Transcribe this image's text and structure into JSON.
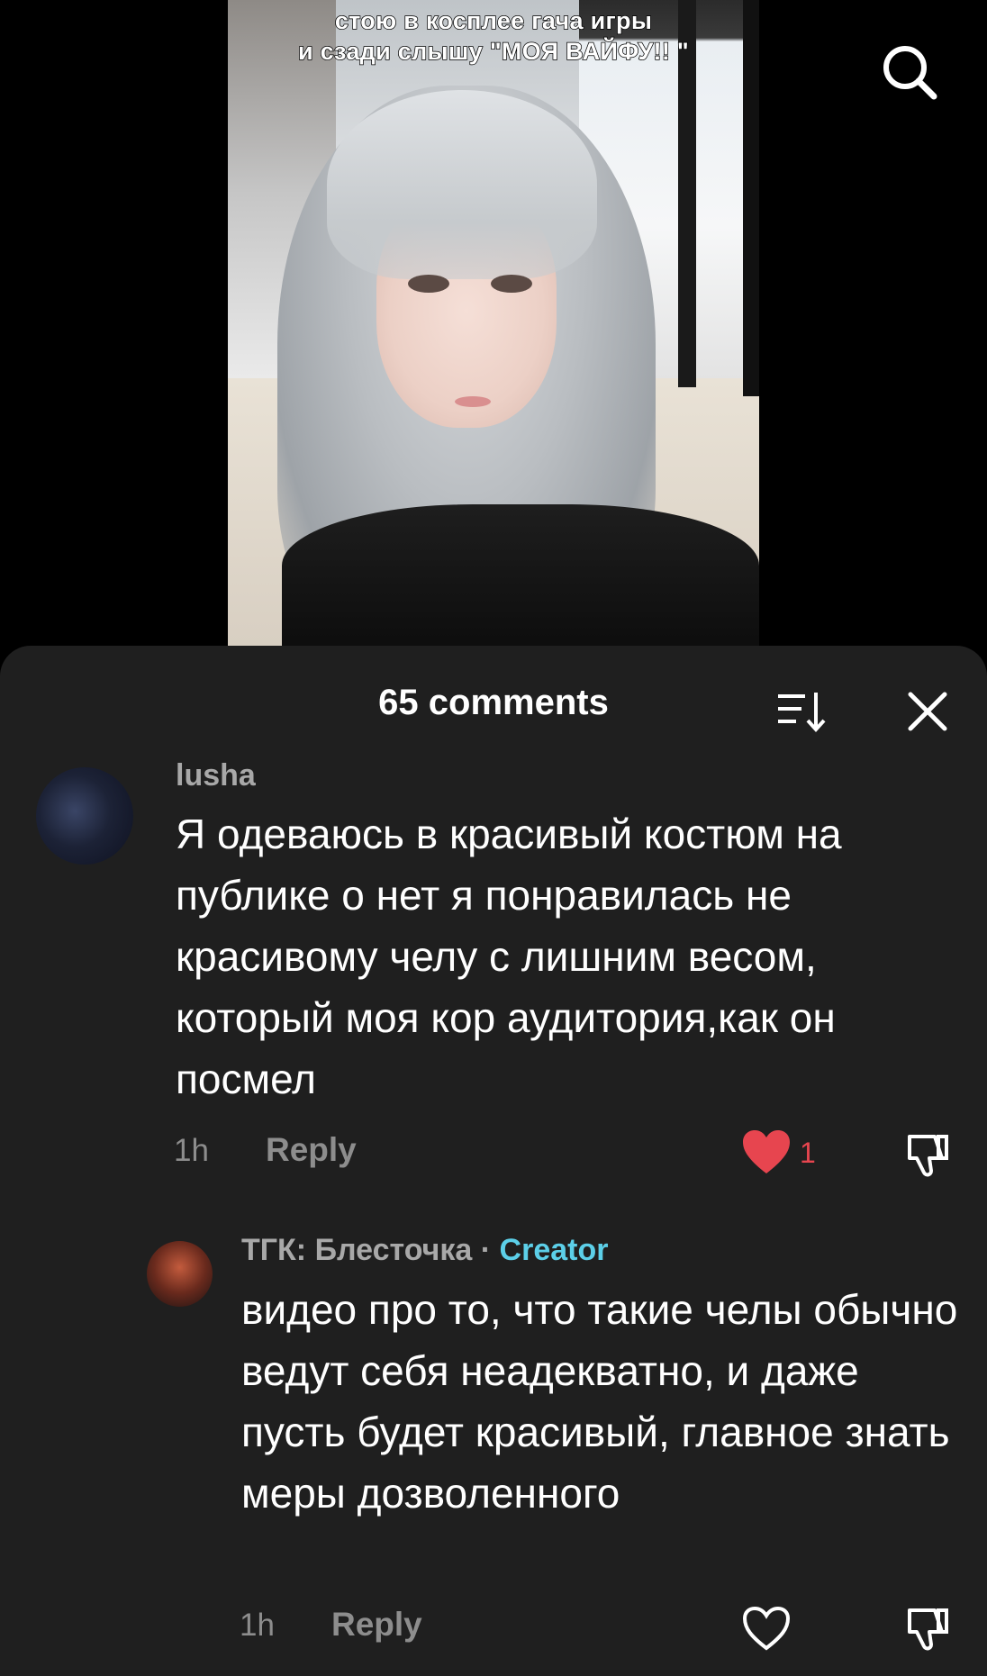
{
  "video": {
    "caption_line1": "стою в косплее гача игры",
    "caption_line2": "и сзади слышу \"МОЯ ВАЙФУ!! \""
  },
  "icons": {
    "search": "search-icon",
    "sort": "sort-icon",
    "close": "close-icon",
    "like": "heart-icon",
    "dislike": "dislike-icon"
  },
  "sheet": {
    "title": "65 comments"
  },
  "comments": [
    {
      "username": "lusha",
      "text": "Я одеваюсь в красивый костюм на публике о нет я понравилась не красивому челу с лишним весом, который моя кор аудитория,как он посмел",
      "time": "1h",
      "reply_label": "Reply",
      "likes": "1",
      "liked": true
    },
    {
      "username": "ТГК: Блесточка",
      "separator": "·",
      "badge": "Creator",
      "text": "видео про то, что такие челы обычно ведут себя неадекватно, и даже пусть будет красивый, главное знать меры дозволенного",
      "time": "1h",
      "reply_label": "Reply",
      "liked": false
    }
  ],
  "colors": {
    "sheet_bg": "#1f1f1f",
    "like_red": "#e7454f",
    "creator_blue": "#5ccfe8",
    "muted_text": "#8d8d8d"
  }
}
